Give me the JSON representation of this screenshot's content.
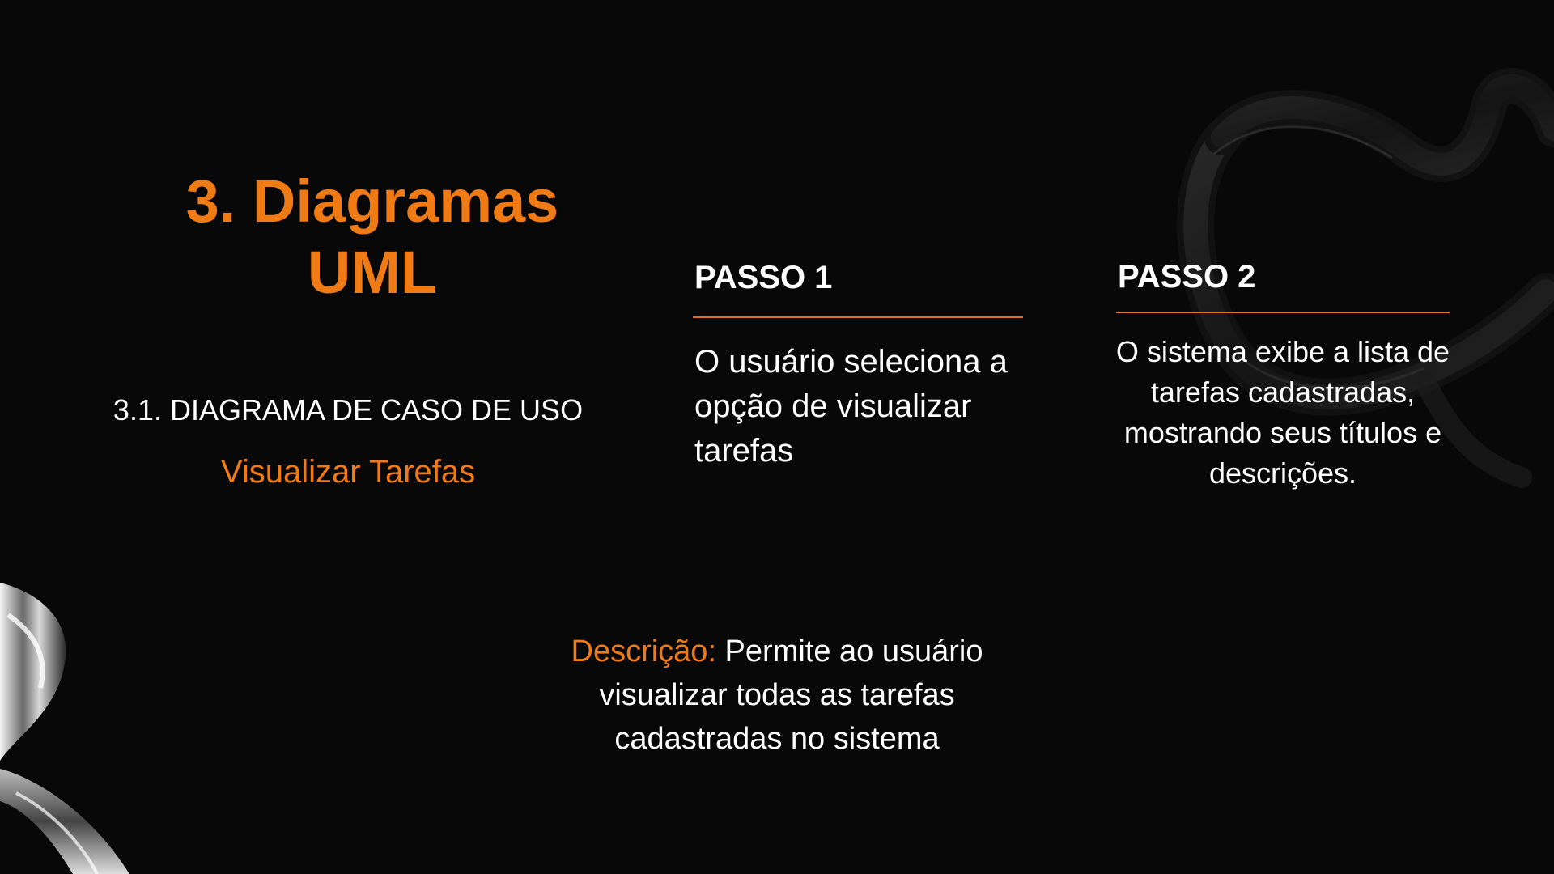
{
  "title": "3. Diagramas UML",
  "subtitle": "3.1. DIAGRAMA DE CASO DE USO",
  "use_case_name": "Visualizar Tarefas",
  "steps": [
    {
      "heading": "PASSO 1",
      "text": "O usuário seleciona a opção de visualizar tarefas"
    },
    {
      "heading": "PASSO 2",
      "text": "O sistema exibe a lista de tarefas cadastradas, mostrando seus títulos e descrições."
    }
  ],
  "description": {
    "label": "Descrição:",
    "text": " Permite ao usuário visualizar todas as tarefas cadastradas no sistema"
  },
  "colors": {
    "background": "#080808",
    "accent": "#f07a14",
    "text": "#ffffff"
  }
}
